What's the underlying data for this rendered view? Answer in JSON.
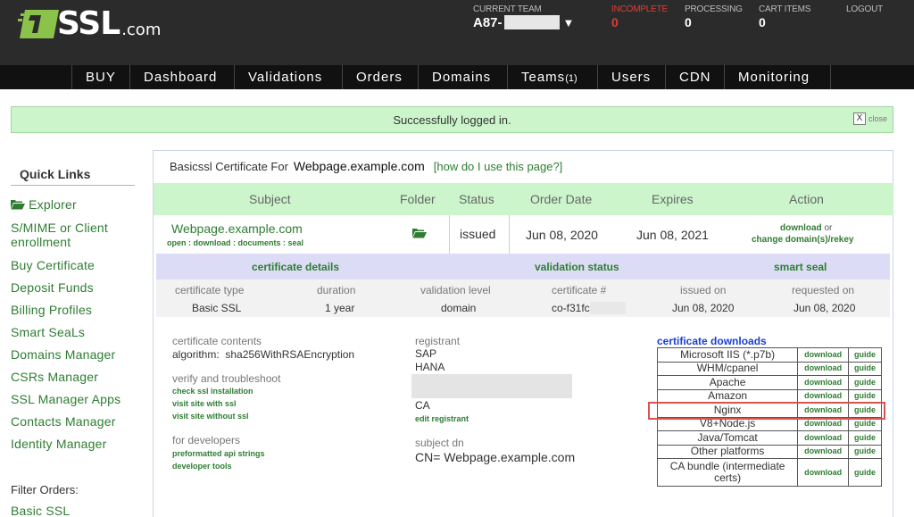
{
  "brand": {
    "logo_text": "SSL",
    "logo_suffix": ".com"
  },
  "header": {
    "team_label": "CURRENT TEAM",
    "team_value": "A87-",
    "incomplete_label": "INCOMPLETE",
    "incomplete_value": "0",
    "processing_label": "PROCESSING",
    "processing_value": "0",
    "cart_label": "CART ITEMS",
    "cart_value": "0",
    "logout_label": "LOGOUT"
  },
  "nav": {
    "items": [
      "BUY",
      "Dashboard",
      "Validations",
      "Orders",
      "Domains",
      "Teams",
      "Users",
      "CDN",
      "Monitoring"
    ],
    "teams_count": "(1)"
  },
  "flash": {
    "message": "Successfully logged in.",
    "close_x": "X",
    "close_label": "close"
  },
  "sidebar": {
    "title": "Quick Links",
    "items": [
      "Explorer",
      "S/MIME or Client",
      "enrollment",
      "Buy Certificate",
      "Deposit Funds",
      "Billing Profiles",
      "Smart SeaLs",
      "Domains Manager",
      "CSRs Manager",
      "SSL Manager Apps",
      "Contacts Manager",
      "Identity Manager"
    ],
    "filter_title": "Filter Orders:",
    "filter_first": "Basic SSL"
  },
  "main": {
    "title_prefix": "Basicssl Certificate For",
    "title_domain": "Webpage.example.com",
    "help_link": "[how do I use this page?]",
    "columns": [
      "Subject",
      "Folder",
      "Status",
      "Order Date",
      "Expires",
      "Action"
    ],
    "row": {
      "domain": "Webpage.example.com",
      "links": "open : download : documents : seal",
      "status": "issued",
      "order_date": "Jun 08, 2020",
      "expires": "Jun 08, 2021",
      "action_download": "download",
      "action_or": "or",
      "action_change": "change domain(s)/rekey"
    },
    "details_bar": {
      "certificate_details": "certificate details",
      "validation_status": "validation status",
      "smart_seal": "smart seal"
    },
    "details": {
      "labels": [
        "certificate type",
        "duration",
        "validation level",
        "certificate #",
        "issued on",
        "requested on"
      ],
      "values": [
        "Basic SSL",
        "1 year",
        "domain",
        "co-f31fc",
        "Jun 08, 2020",
        "Jun 08, 2020"
      ]
    },
    "contents": {
      "label": "certificate contents",
      "algorithm_label": "algorithm:",
      "algorithm_value": "sha256WithRSAEncryption",
      "verify_label": "verify and troubleshoot",
      "verify_links": [
        "check ssl installation",
        "visit site with ssl",
        "visit site without ssl"
      ],
      "dev_label": "for developers",
      "dev_links": [
        "preformatted api strings",
        "developer tools"
      ]
    },
    "registrant": {
      "label": "registrant",
      "lines": [
        "SAP",
        "HANA"
      ],
      "country": "CA",
      "edit_link": "edit registrant",
      "subject_dn_label": "subject dn",
      "subject_dn_value": "CN= Webpage.example.com"
    },
    "downloads": {
      "title": "certificate downloads",
      "download_label": "download",
      "guide_label": "guide",
      "platforms": [
        "Microsoft IIS (*.p7b)",
        "WHM/cpanel",
        "Apache",
        "Amazon",
        "Nginx",
        "V8+Node.js",
        "Java/Tomcat",
        "Other platforms",
        "CA bundle (intermediate certs)"
      ]
    }
  }
}
